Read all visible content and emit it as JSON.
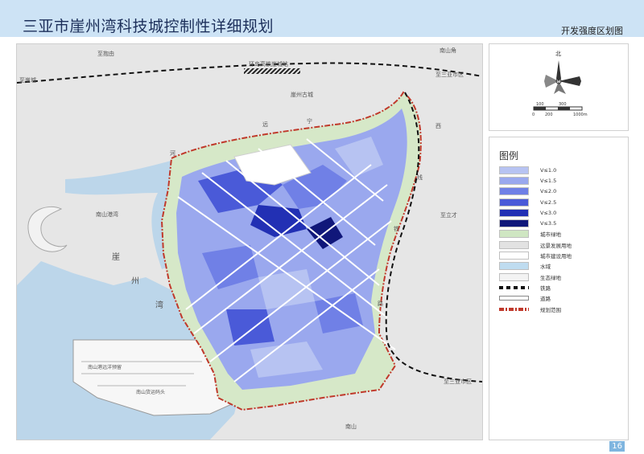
{
  "header": {
    "title": "三亚市崖州湾科技城控制性详细规划",
    "subtitle": "开发强度区划图"
  },
  "page_number": "16",
  "colors": {
    "header_band": "#cde3f5",
    "water": "#bcd6ea",
    "base_land": "#e6e6e6",
    "city_green": "#d6e8c8",
    "boundary": "#c0392b"
  },
  "map": {
    "labels": {
      "zhibao": "至抱由",
      "zhiyacheng": "至崖城",
      "zhisanya_n": "至三亚市区",
      "zhisanya_s": "至三亚市区",
      "zhili": "至立才",
      "station": "环岛高铁崖城站",
      "old_town": "崖州古城",
      "nanshan_jiao": "南山角",
      "nanshan": "南山",
      "ning": "宁",
      "yuan": "远",
      "he": "河",
      "xi": "西",
      "xian": "线",
      "tie": "铁",
      "lu": "路",
      "nanshan_river": "南山港湾",
      "bay_ya": "崖",
      "bay_zhou": "州",
      "bay_wan": "湾",
      "nanshan_port": "南山港远洋预留",
      "nanshan_terminal": "南山货运码头"
    }
  },
  "compass": {
    "north": "北",
    "scale_top": [
      "100",
      "300"
    ],
    "scale_bottom": [
      "0",
      "200",
      "1000m"
    ]
  },
  "legend": {
    "title": "图例",
    "items": [
      {
        "label": "V≤1.0",
        "color": "#b7c3f2",
        "kind": "fill"
      },
      {
        "label": "V≤1.5",
        "color": "#9aa8ee",
        "kind": "fill"
      },
      {
        "label": "V≤2.0",
        "color": "#7080e6",
        "kind": "fill"
      },
      {
        "label": "V≤2.5",
        "color": "#4a5ad8",
        "kind": "fill"
      },
      {
        "label": "V≤3.0",
        "color": "#2230b4",
        "kind": "fill"
      },
      {
        "label": "V≤3.5",
        "color": "#10177a",
        "kind": "fill"
      },
      {
        "label": "城市绿地",
        "color": "#cfe6c2",
        "kind": "fill"
      },
      {
        "label": "远景发展用地",
        "color": "#e2e2e2",
        "kind": "fill"
      },
      {
        "label": "城市建设用地",
        "color": "#ffffff",
        "kind": "fill"
      },
      {
        "label": "水域",
        "color": "#bfdcf0",
        "kind": "fill"
      },
      {
        "label": "生态绿地",
        "color": "#f3f3f3",
        "kind": "fill"
      },
      {
        "label": "铁路",
        "color": "#111111",
        "kind": "railway"
      },
      {
        "label": "道路",
        "color": "#ffffff",
        "kind": "road"
      },
      {
        "label": "规划范围",
        "color": "#c0392b",
        "kind": "boundary"
      }
    ]
  }
}
